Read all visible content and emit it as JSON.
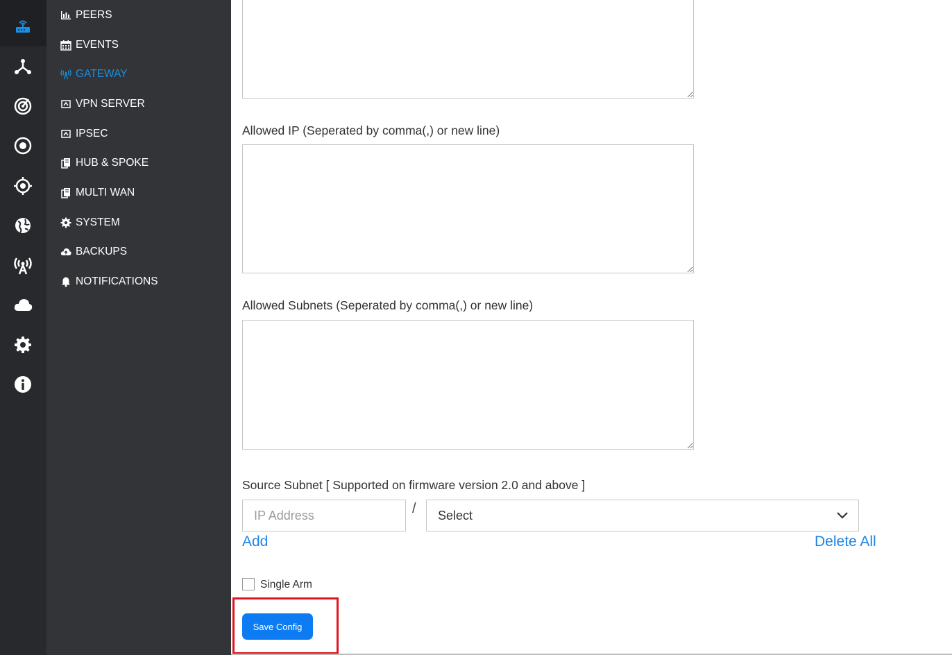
{
  "sidebar_rail": {
    "icons": [
      "router-icon",
      "topology-icon",
      "radar-icon",
      "target-icon",
      "crosshair-icon",
      "globe-icon",
      "antenna-icon",
      "cloud-icon",
      "gear-icon",
      "info-icon"
    ],
    "active_color": "#1b8fe0"
  },
  "menu": {
    "items": [
      {
        "label": "PEERS",
        "icon": "bar-chart-icon"
      },
      {
        "label": "EVENTS",
        "icon": "calendar-icon"
      },
      {
        "label": "GATEWAY",
        "icon": "wifi-tower-icon",
        "active": true
      },
      {
        "label": "VPN SERVER",
        "icon": "vpn-icon"
      },
      {
        "label": "IPSEC",
        "icon": "ipsec-icon"
      },
      {
        "label": "HUB & SPOKE",
        "icon": "hub-icon"
      },
      {
        "label": "MULTI WAN",
        "icon": "multi-wan-icon"
      },
      {
        "label": "SYSTEM",
        "icon": "gear-icon"
      },
      {
        "label": "BACKUPS",
        "icon": "cloud-upload-icon"
      },
      {
        "label": "NOTIFICATIONS",
        "icon": "bell-icon"
      }
    ]
  },
  "form": {
    "allowed_ip_label": "Allowed IP (Seperated by comma(,) or new line)",
    "allowed_subnets_label": "Allowed Subnets (Seperated by comma(,) or new line)",
    "source_subnet_label": "Source Subnet [ Supported on firmware version 2.0 and above ]",
    "ip_placeholder": "IP Address",
    "slash": "/",
    "select_value": "Select",
    "add_label": "Add",
    "delete_all_label": "Delete All",
    "single_arm_label": "Single Arm",
    "save_label": "Save Config"
  },
  "colors": {
    "rail_bg": "#27292d",
    "menu_bg": "#323437",
    "accent": "#1b85e8",
    "button": "#0d7cf2",
    "highlight": "#e0161f"
  }
}
